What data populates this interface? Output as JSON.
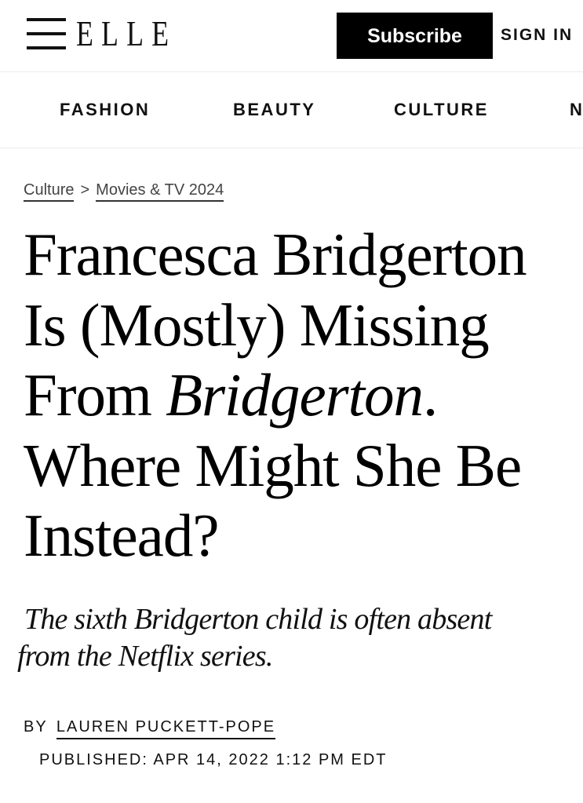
{
  "header": {
    "menu_icon": "hamburger-menu-icon",
    "logo": "ELLE",
    "subscribe_label": "Subscribe",
    "sign_in_label": "SIGN IN"
  },
  "nav": {
    "items": [
      {
        "label": "FASHION"
      },
      {
        "label": "BEAUTY"
      },
      {
        "label": "CULTURE"
      },
      {
        "label": "N"
      }
    ]
  },
  "article": {
    "breadcrumb": {
      "items": [
        "Culture",
        "Movies & TV 2024"
      ],
      "separator": ">"
    },
    "headline": {
      "line1": "Francesca Bridgerton",
      "line2": "Is (Mostly) Missing",
      "line3_prefix": "From ",
      "line3_italic": "Bridgerton",
      "line3_suffix": ".",
      "line4": "Where Might She Be",
      "line5": "Instead?"
    },
    "dek": {
      "line1": "The sixth Bridgerton child is often absent",
      "line2": "from the Netflix series."
    },
    "byline": {
      "prefix": "BY",
      "author": "LAUREN PUCKETT-POPE"
    },
    "published": "PUBLISHED: APR 14, 2022 1:12 PM EDT"
  },
  "colors": {
    "text": "#111111",
    "background": "#ffffff",
    "button_bg": "#000000",
    "button_text": "#ffffff",
    "divider": "#ececec"
  }
}
